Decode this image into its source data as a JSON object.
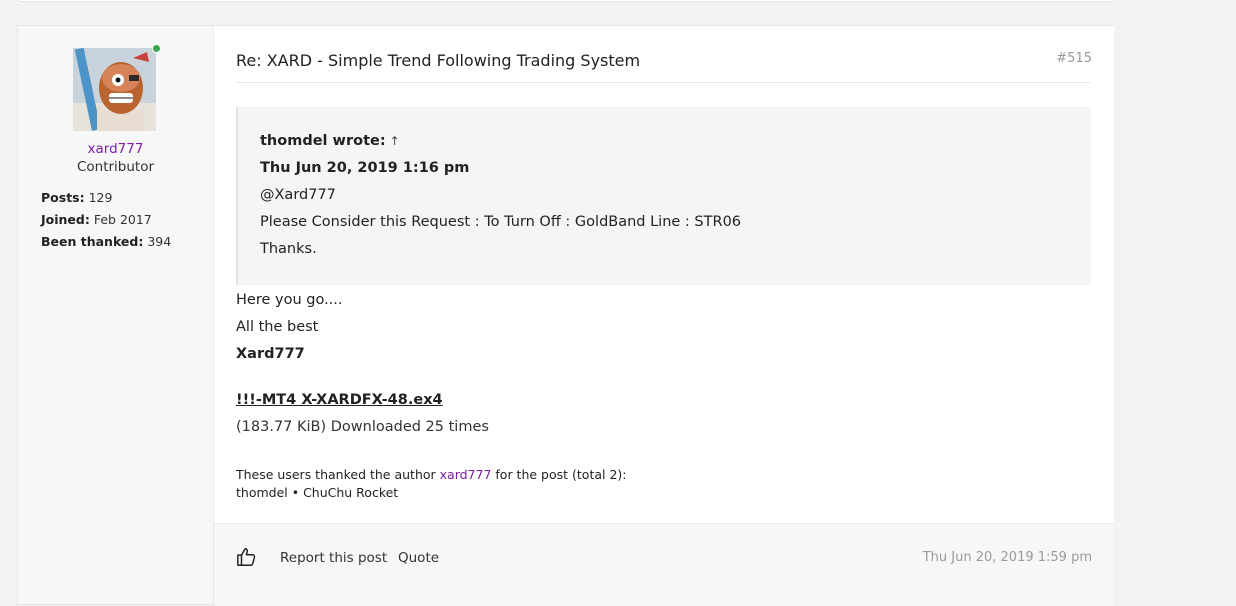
{
  "post": {
    "title": "Re: XARD - Simple Trend Following Trading System",
    "number": "#515",
    "author": {
      "username": "xard777",
      "rank": "Contributor",
      "online": true,
      "posts_label": "Posts:",
      "posts": "129",
      "joined_label": "Joined:",
      "joined": "Feb 2017",
      "thanked_label": "Been thanked:",
      "thanked": "394"
    },
    "quote": {
      "author_line": "thomdel wrote:",
      "jump_icon": "up-arrow-icon",
      "date": "Thu Jun 20, 2019 1:16 pm",
      "lines": [
        "@Xard777",
        "Please Consider this Request : To Turn Off : GoldBand Line : STR06",
        "Thanks."
      ]
    },
    "body": {
      "lines": [
        "Here you go....",
        "All the best"
      ],
      "signature": "Xard777"
    },
    "attachment": {
      "filename": "!!!-MT4 X-XARDFX-48.ex4",
      "meta": "(183.77 KiB) Downloaded 25 times"
    },
    "thanks": {
      "prefix": "These users thanked the author ",
      "author": "xard777",
      "suffix": " for the post (total 2):",
      "users": "thomdel • ChuChu Rocket"
    },
    "footer": {
      "like_icon": "thumbs-up-icon",
      "report_label": "Report this post",
      "quote_label": "Quote",
      "date": "Thu Jun 20, 2019 1:59 pm"
    }
  },
  "colors": {
    "username": "#7a1fa2",
    "online": "#3aa74b",
    "muted": "#9a9a9a"
  }
}
